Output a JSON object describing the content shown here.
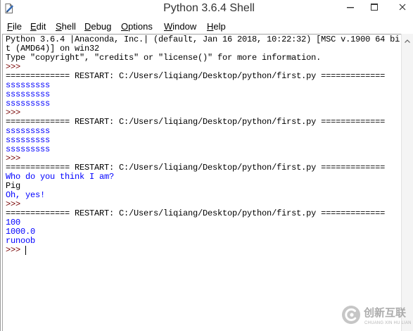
{
  "window": {
    "title": "Python 3.6.4 Shell",
    "icon": "idle-app-icon",
    "controls": {
      "minimize": "minimize-icon",
      "maximize": "maximize-icon",
      "close": "close-icon"
    }
  },
  "menu": {
    "items": [
      {
        "label": "File"
      },
      {
        "label": "Edit"
      },
      {
        "label": "Shell"
      },
      {
        "label": "Debug"
      },
      {
        "label": "Options"
      },
      {
        "label": "Window"
      },
      {
        "label": "Help"
      }
    ]
  },
  "colors": {
    "text": "#000000",
    "stdout_text": "#0000ff",
    "prompt": "#770000",
    "background": "#ffffff"
  },
  "shell": {
    "lines": [
      {
        "text": "Python 3.6.4 |Anaconda, Inc.| (default, Jan 16 2018, 10:22:32) [MSC v.1900 64 bi",
        "color": "#000000"
      },
      {
        "text": "t (AMD64)] on win32",
        "color": "#000000"
      },
      {
        "text": "Type \"copyright\", \"credits\" or \"license()\" for more information.",
        "color": "#000000"
      },
      {
        "text": ">>> ",
        "color": "#770000"
      },
      {
        "text": "============= RESTART: C:/Users/liqiang/Desktop/python/first.py =============",
        "color": "#000000"
      },
      {
        "text": "sssssssss",
        "color": "#0000ff"
      },
      {
        "text": "sssssssss",
        "color": "#0000ff"
      },
      {
        "text": "sssssssss",
        "color": "#0000ff"
      },
      {
        "text": ">>> ",
        "color": "#770000"
      },
      {
        "text": "============= RESTART: C:/Users/liqiang/Desktop/python/first.py =============",
        "color": "#000000"
      },
      {
        "text": "sssssssss",
        "color": "#0000ff"
      },
      {
        "text": "sssssssss",
        "color": "#0000ff"
      },
      {
        "text": "sssssssss",
        "color": "#0000ff"
      },
      {
        "text": ">>> ",
        "color": "#770000"
      },
      {
        "text": "============= RESTART: C:/Users/liqiang/Desktop/python/first.py =============",
        "color": "#000000"
      },
      {
        "text": "Who do you think I am?",
        "color": "#0000ff"
      },
      {
        "text": "Pig",
        "color": "#000000"
      },
      {
        "text": "Oh, yes!",
        "color": "#0000ff"
      },
      {
        "text": ">>> ",
        "color": "#770000"
      },
      {
        "text": "============= RESTART: C:/Users/liqiang/Desktop/python/first.py =============",
        "color": "#000000"
      },
      {
        "text": "100",
        "color": "#0000ff"
      },
      {
        "text": "1000.0",
        "color": "#0000ff"
      },
      {
        "text": "runoob",
        "color": "#0000ff"
      },
      {
        "text": ">>> ",
        "color": "#770000"
      }
    ]
  },
  "scrollbar": {
    "up_arrow": "scroll-up-arrow-icon"
  },
  "watermark": {
    "logo": "watermark-logo-icon",
    "text": "创新互联",
    "subtitle": "CHUANG XIN HU LIAN"
  }
}
